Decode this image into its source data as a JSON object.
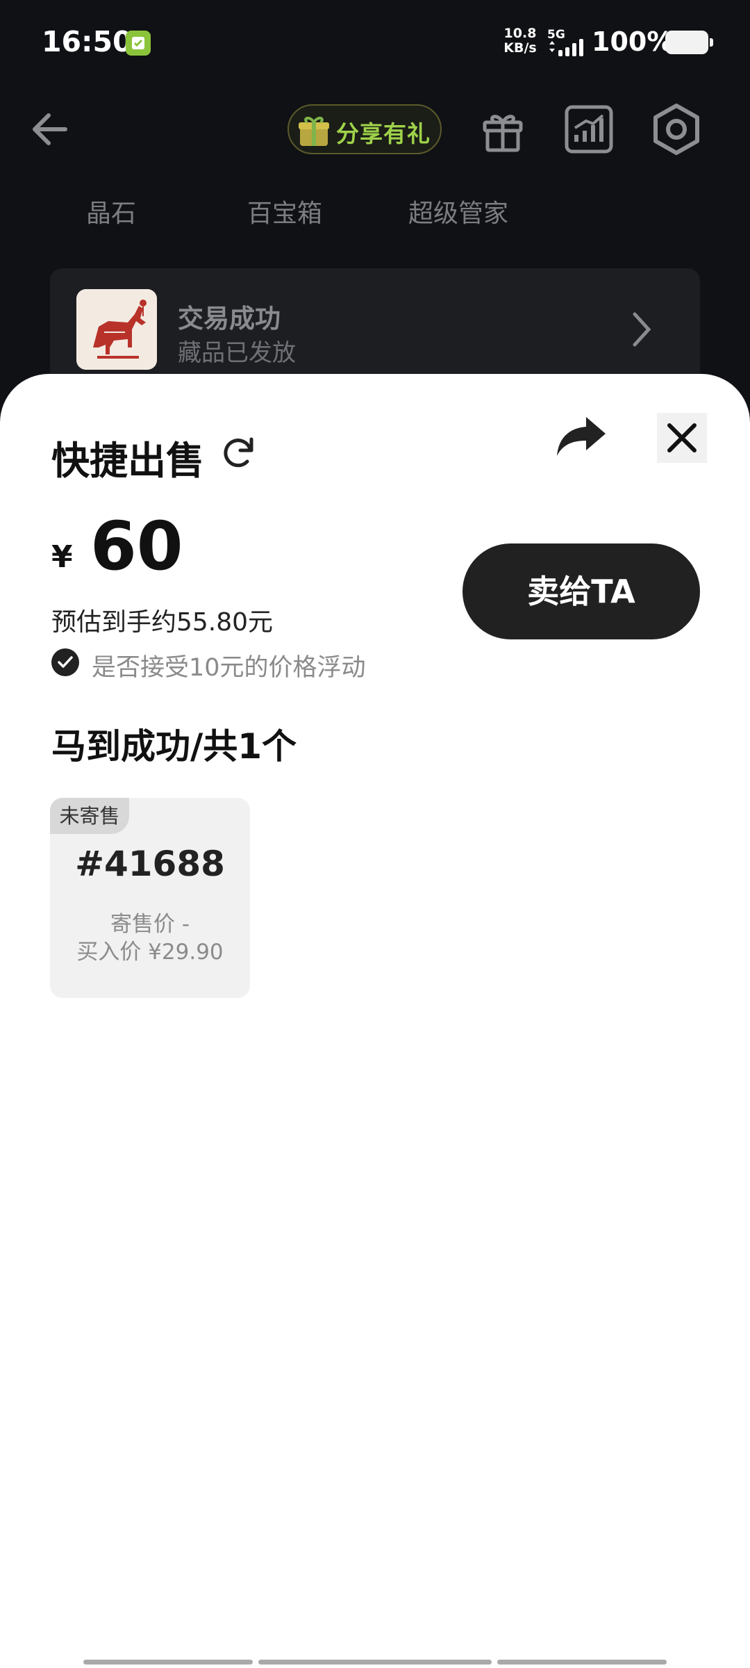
{
  "status": {
    "time": "16:50",
    "speed_top": "10.8",
    "speed_bottom": "KB/s",
    "network": "5G",
    "battery": "100%"
  },
  "header": {
    "share_gift_label": "分享有礼"
  },
  "tabs": [
    "晶石",
    "百宝箱",
    "超级管家"
  ],
  "success_card": {
    "title": "交易成功",
    "subtitle": "藏品已发放"
  },
  "sheet": {
    "title": "快捷出售",
    "currency": "¥",
    "price": "60",
    "estimate": "预估到手约55.80元",
    "accept_fluctuation": "是否接受10元的价格浮动",
    "sell_button": "卖给TA",
    "list_title": "马到成功/共1个",
    "items": [
      {
        "tag": "未寄售",
        "number": "#41688",
        "consign_price": "寄售价 -",
        "buy_price": "买入价 ¥29.90"
      }
    ]
  },
  "colors": {
    "accent_green": "#9fd24a",
    "dark_button": "#212121",
    "sheet_bg": "#ffffff",
    "page_bg": "#101114"
  }
}
